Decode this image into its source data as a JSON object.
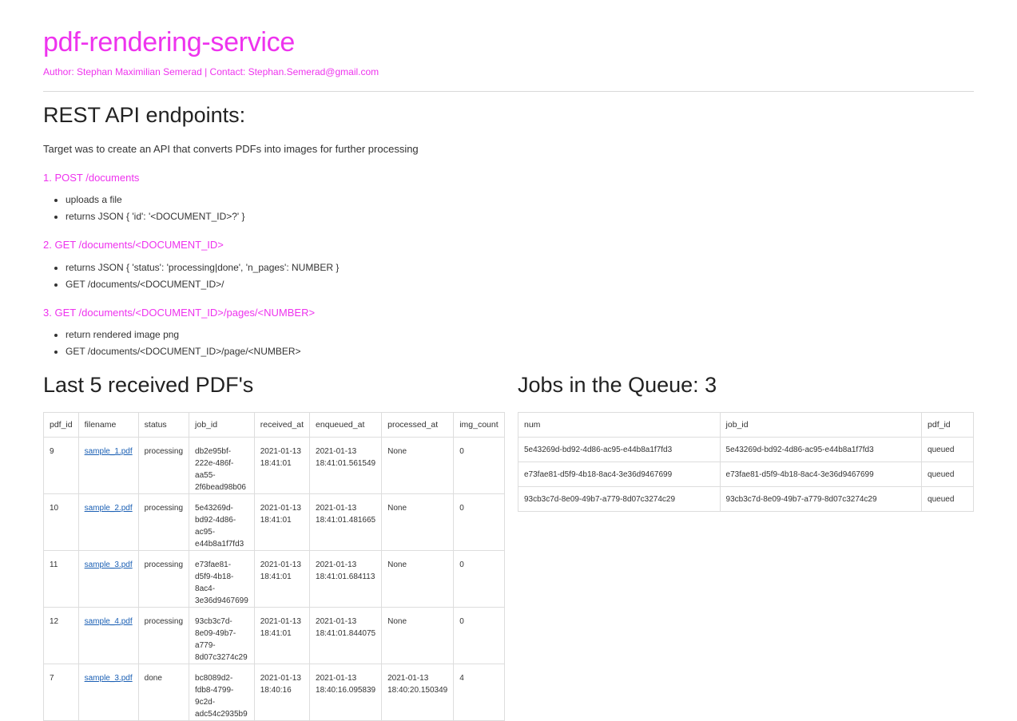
{
  "header": {
    "title": "pdf-rendering-service",
    "author_line": "Author: Stephan Maximilian Semerad | Contact: Stephan.Semerad@gmail.com"
  },
  "api": {
    "heading": "REST API endpoints:",
    "intro": "Target was to create an API that converts PDFs into images for further processing",
    "endpoints": [
      {
        "title": "1. POST /documents",
        "items": [
          "uploads a file",
          "returns JSON { 'id': '<DOCUMENT_ID>?' }"
        ]
      },
      {
        "title": "2. GET /documents/<DOCUMENT_ID>",
        "items": [
          "returns JSON { 'status': 'processing|done', 'n_pages': NUMBER }",
          "GET /documents/<DOCUMENT_ID>/"
        ]
      },
      {
        "title": "3. GET /documents/<DOCUMENT_ID>/pages/<NUMBER>",
        "items": [
          "return rendered image png",
          "GET /documents/<DOCUMENT_ID>/page/<NUMBER>"
        ]
      }
    ]
  },
  "last_pdfs": {
    "heading": "Last 5 received PDF's",
    "columns": [
      "pdf_id",
      "filename",
      "status",
      "job_id",
      "received_at",
      "enqueued_at",
      "processed_at",
      "img_count"
    ],
    "rows": [
      [
        "9",
        "sample_1.pdf",
        "processing",
        "db2e95bf-222e-486f-aa55-2f6bead98b06",
        "2021-01-13 18:41:01",
        "2021-01-13 18:41:01.561549",
        "None",
        "0"
      ],
      [
        "10",
        "sample_2.pdf",
        "processing",
        "5e43269d-bd92-4d86-ac95-e44b8a1f7fd3",
        "2021-01-13 18:41:01",
        "2021-01-13 18:41:01.481665",
        "None",
        "0"
      ],
      [
        "11",
        "sample_3.pdf",
        "processing",
        "e73fae81-d5f9-4b18-8ac4-3e36d9467699",
        "2021-01-13 18:41:01",
        "2021-01-13 18:41:01.684113",
        "None",
        "0"
      ],
      [
        "12",
        "sample_4.pdf",
        "processing",
        "93cb3c7d-8e09-49b7-a779-8d07c3274c29",
        "2021-01-13 18:41:01",
        "2021-01-13 18:41:01.844075",
        "None",
        "0"
      ],
      [
        "7",
        "sample_3.pdf",
        "done",
        "bc8089d2-fdb8-4799-9c2d-adc54c2935b9",
        "2021-01-13 18:40:16",
        "2021-01-13 18:40:16.095839",
        "2021-01-13 18:40:20.150349",
        "4"
      ]
    ]
  },
  "queue": {
    "heading_label": "Jobs in the Queue:",
    "count": "3",
    "columns": [
      "num",
      "job_id",
      "pdf_id"
    ],
    "rows": [
      [
        "5e43269d-bd92-4d86-ac95-e44b8a1f7fd3",
        "5e43269d-bd92-4d86-ac95-e44b8a1f7fd3",
        "queued"
      ],
      [
        "e73fae81-d5f9-4b18-8ac4-3e36d9467699",
        "e73fae81-d5f9-4b18-8ac4-3e36d9467699",
        "queued"
      ],
      [
        "93cb3c7d-8e09-49b7-a779-8d07c3274c29",
        "93cb3c7d-8e09-49b7-a779-8d07c3274c29",
        "queued"
      ]
    ]
  },
  "colors": {
    "accent": "#ee33ee",
    "link": "#1a5fb4",
    "border": "#dddddd",
    "text": "#333333"
  }
}
